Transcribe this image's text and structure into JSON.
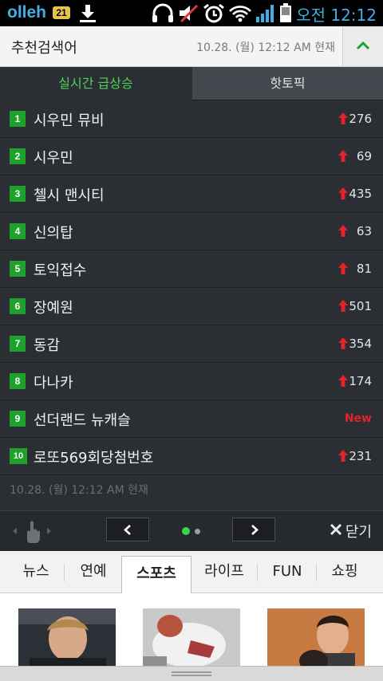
{
  "status_bar": {
    "carrier": "olleh",
    "badge": "21",
    "clock": "오전 12:12"
  },
  "recommend": {
    "title": "추천검색어",
    "timestamp": "10.28. (월) 12:12 AM 현재"
  },
  "tabs": [
    {
      "label": "실시간 급상승"
    },
    {
      "label": "핫토픽"
    }
  ],
  "rows": [
    {
      "rank": "1",
      "keyword": "시우민 뮤비",
      "count": "276"
    },
    {
      "rank": "2",
      "keyword": "시우민",
      "count": "69"
    },
    {
      "rank": "3",
      "keyword": "첼시 맨시티",
      "count": "435"
    },
    {
      "rank": "4",
      "keyword": "신의탑",
      "count": "63"
    },
    {
      "rank": "5",
      "keyword": "토익접수",
      "count": "81"
    },
    {
      "rank": "6",
      "keyword": "장예원",
      "count": "501"
    },
    {
      "rank": "7",
      "keyword": "동감",
      "count": "354"
    },
    {
      "rank": "8",
      "keyword": "다나카",
      "count": "174"
    },
    {
      "rank": "9",
      "keyword": "선더랜드 뉴캐슬",
      "count": "New"
    },
    {
      "rank": "10",
      "keyword": "로또569회당첨번호",
      "count": "231"
    }
  ],
  "panel_footer": {
    "timestamp": "10.28. (월) 12:12 AM 현재",
    "close_label": "닫기",
    "page_index": 1,
    "page_count": 2
  },
  "categories": [
    {
      "label": "뉴스"
    },
    {
      "label": "연예"
    },
    {
      "label": "스포츠"
    },
    {
      "label": "라이프"
    },
    {
      "label": "FUN"
    },
    {
      "label": "쇼핑"
    }
  ],
  "colors": {
    "accent_green": "#4cd25c",
    "rank_green": "#1fa12d",
    "rise_red": "#e3232b",
    "panel_bg": "#2b2e33",
    "status_blue": "#3fb0e6"
  },
  "icons": [
    "download-icon",
    "headphones-icon",
    "mute-icon",
    "alarm-icon",
    "wifi-icon",
    "signal-icon",
    "battery-icon",
    "chevron-up-icon",
    "arrow-up-icon",
    "swipe-hand-icon",
    "chevron-left-icon",
    "chevron-right-icon",
    "close-icon"
  ]
}
